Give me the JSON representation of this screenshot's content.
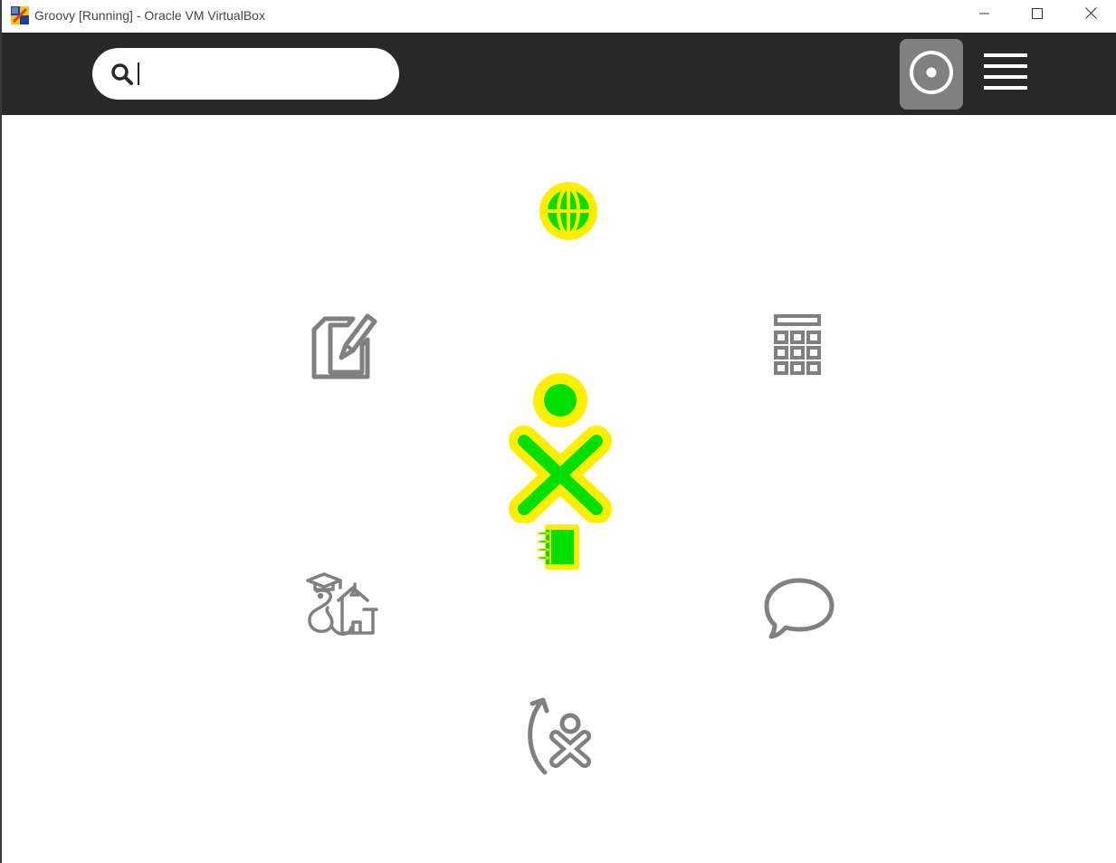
{
  "window": {
    "title": "Groovy [Running] - Oracle VM VirtualBox"
  },
  "titlebar": {
    "icons": [
      "virtualbox-icon",
      "minimize-icon",
      "maximize-icon",
      "close-icon"
    ]
  },
  "toolbar": {
    "search": {
      "value": "",
      "placeholder": ""
    },
    "icons": [
      "search-icon",
      "ring-view-icon",
      "hamburger-menu-icon"
    ]
  },
  "home": {
    "activities": [
      {
        "name": "browse",
        "icon": "globe-icon",
        "active": true
      },
      {
        "name": "write",
        "icon": "pencil-document-icon",
        "active": false
      },
      {
        "name": "calculate",
        "icon": "calculator-icon",
        "active": false
      },
      {
        "name": "pippy",
        "icon": "snake-school-icon",
        "active": false
      },
      {
        "name": "chat",
        "icon": "speech-bubble-icon",
        "active": false
      },
      {
        "name": "software-update",
        "icon": "xo-update-icon",
        "active": false
      },
      {
        "name": "journal",
        "icon": "notebook-icon",
        "active": true
      }
    ],
    "buddy": {
      "icon": "xo-buddy-icon"
    }
  },
  "colors": {
    "toolbar_bg": "#282828",
    "xo_fill": "#00e000",
    "xo_stroke": "#ffee00",
    "inactive_icon": "#808080",
    "selected_view_bg": "#808080"
  }
}
